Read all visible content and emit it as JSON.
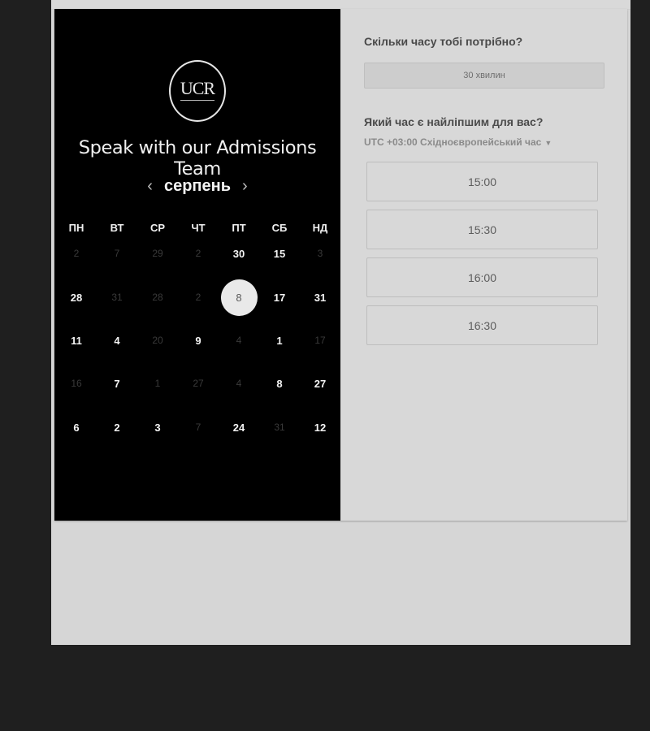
{
  "brand": {
    "logo_text": "UCR"
  },
  "calendar": {
    "heading": "Speak with our Admissions Team",
    "month": "серпень",
    "prev_arrow": "‹",
    "next_arrow": "›",
    "weekdays": [
      "ПН",
      "ВТ",
      "СР",
      "ЧТ",
      "ПТ",
      "СБ",
      "НД"
    ],
    "weeks": [
      [
        "2",
        "7",
        "29",
        "2",
        "30",
        "15",
        "3"
      ],
      [
        "28",
        "31",
        "28",
        "2",
        "8",
        "17",
        "31"
      ],
      [
        "11",
        "4",
        "20",
        "9",
        "4",
        "1",
        "17"
      ],
      [
        "16",
        "7",
        "1",
        "27",
        "4",
        "8",
        "27"
      ],
      [
        "6",
        "2",
        "3",
        "7",
        "24",
        "31",
        "12"
      ]
    ],
    "selected_day": "8"
  },
  "booking": {
    "duration_question": "Скільки часу тобі потрібно?",
    "duration_value": "30 хвилин",
    "time_question": "Який час є найліпшим для вас?",
    "timezone": "UTC +03:00 Східноєвропейський час",
    "time_slots": [
      "15:00",
      "15:30",
      "16:00",
      "16:30"
    ]
  },
  "colors": {
    "panel_dark": "#000000",
    "page_bg": "#d6d6d6",
    "backdrop": "#1f1f1f"
  }
}
